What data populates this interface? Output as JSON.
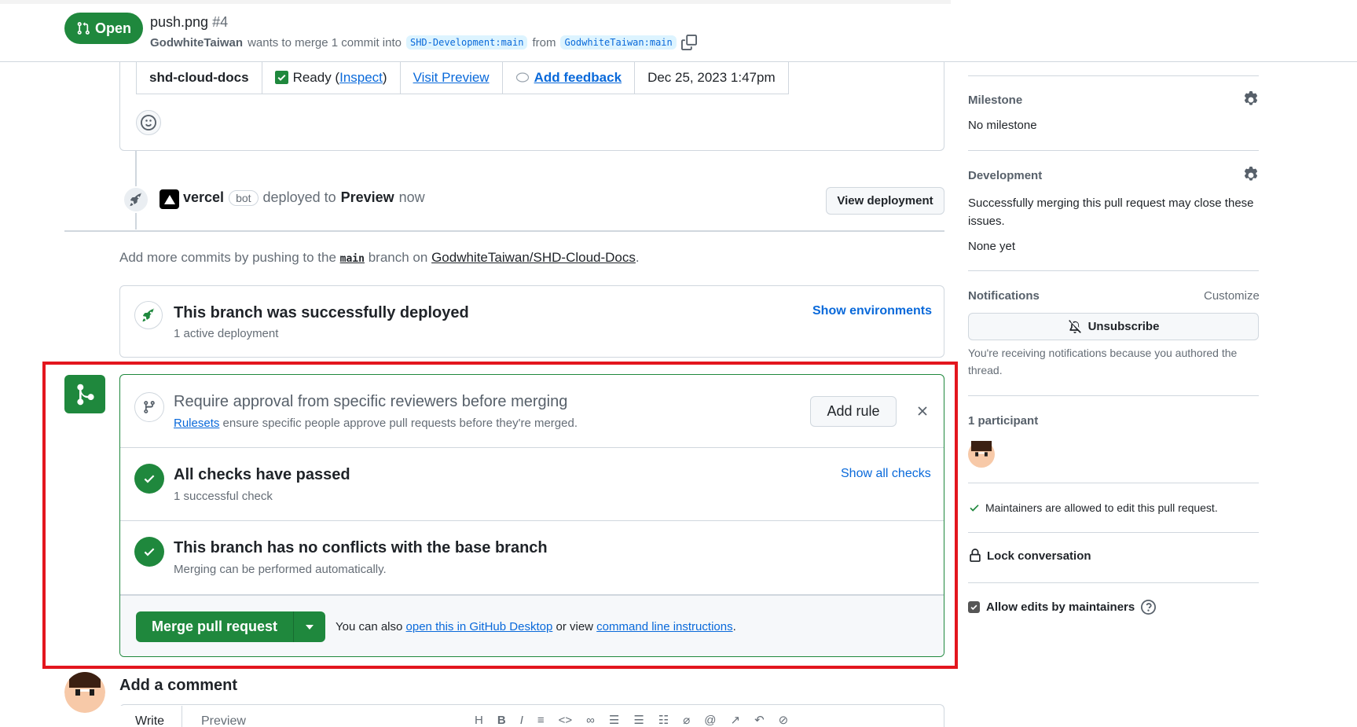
{
  "header": {
    "badge": "Open",
    "title": "push.png",
    "number": "#4",
    "author": "GodwhiteTaiwan",
    "merge_text": "wants to merge 1 commit into",
    "base_branch": "SHD-Development:main",
    "from_text": "from",
    "head_branch": "GodwhiteTaiwan:main"
  },
  "deploy_table": {
    "project": "shd-cloud-docs",
    "status_ready": "Ready (",
    "inspect": "Inspect",
    "status_close": ")",
    "visit_preview": "Visit Preview",
    "add_feedback": "Add feedback",
    "date": "Dec 25, 2023 1:47pm"
  },
  "deploy_event": {
    "actor": "vercel",
    "bot": "bot",
    "action": "deployed to",
    "env": "Preview",
    "when": "now",
    "view_button": "View deployment"
  },
  "add_commits": {
    "prefix": "Add more commits by pushing to the",
    "branch": "main",
    "middle": "branch on",
    "repo": "GodwhiteTaiwan/SHD-Cloud-Docs",
    "suffix": "."
  },
  "deployed": {
    "title": "This branch was successfully deployed",
    "subtitle": "1 active deployment",
    "show_env": "Show environments"
  },
  "merge_box": {
    "approval_title": "Require approval from specific reviewers before merging",
    "rulesets_link": "Rulesets",
    "rulesets_text": "ensure specific people approve pull requests before they're merged.",
    "add_rule": "Add rule",
    "checks_title": "All checks have passed",
    "checks_sub": "1 successful check",
    "show_checks": "Show all checks",
    "conflicts_title": "This branch has no conflicts with the base branch",
    "conflicts_sub": "Merging can be performed automatically.",
    "merge_button": "Merge pull request",
    "also_prefix": "You can also",
    "desktop_link": "open this in GitHub Desktop",
    "or_view": "or view",
    "cli_link": "command line instructions",
    "also_suffix": "."
  },
  "comment": {
    "heading": "Add a comment",
    "tab_write": "Write",
    "tab_preview": "Preview"
  },
  "sidebar": {
    "milestone_head": "Milestone",
    "milestone_value": "No milestone",
    "development_head": "Development",
    "development_text": "Successfully merging this pull request may close these issues.",
    "development_value": "None yet",
    "notifications_head": "Notifications",
    "customize": "Customize",
    "unsubscribe": "Unsubscribe",
    "notify_reason": "You're receiving notifications because you authored the thread.",
    "participants": "1 participant",
    "maintainers_edit": "Maintainers are allowed to edit this pull request.",
    "lock": "Lock conversation",
    "allow_edits": "Allow edits by maintainers"
  },
  "colors": {
    "accent_green": "#1f883d",
    "link_blue": "#0969da",
    "highlight_red": "#e3161e"
  }
}
